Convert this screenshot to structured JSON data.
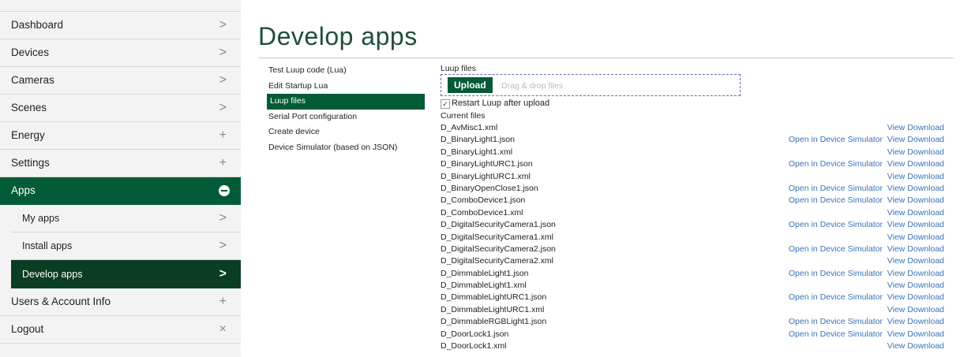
{
  "sidebar": {
    "items": [
      {
        "label": "Dashboard",
        "indicator": ">"
      },
      {
        "label": "Devices",
        "indicator": ">"
      },
      {
        "label": "Cameras",
        "indicator": ">"
      },
      {
        "label": "Scenes",
        "indicator": ">"
      },
      {
        "label": "Energy",
        "indicator": "+"
      },
      {
        "label": "Settings",
        "indicator": "+"
      },
      {
        "label": "Apps",
        "indicator": "minus-circle-icon"
      }
    ],
    "subitems": [
      {
        "label": "My apps",
        "indicator": ">"
      },
      {
        "label": "Install apps",
        "indicator": ">"
      },
      {
        "label": "Develop apps",
        "indicator": ">"
      }
    ],
    "bottom_items": [
      {
        "label": "Users & Account Info",
        "indicator": "+"
      },
      {
        "label": "Logout",
        "indicator": "×"
      }
    ]
  },
  "page": {
    "title": "Develop apps"
  },
  "submenu": {
    "items": [
      "Test Luup code (Lua)",
      "Edit Startup Lua",
      "Luup files",
      "Serial Port configuration",
      "Create device",
      "Device Simulator (based on JSON)"
    ]
  },
  "luup_files": {
    "heading": "Luup files",
    "upload_label": "Upload",
    "drop_hint": "Drag & drop files",
    "restart_label": "Restart Luup after upload",
    "restart_checked": true,
    "current_files_label": "Current files",
    "open_sim_label": "Open in Device Simulator",
    "view_label": "View",
    "download_label": "Download",
    "files": [
      {
        "name": "D_AvMisc1.xml",
        "sim": false
      },
      {
        "name": "D_BinaryLight1.json",
        "sim": true
      },
      {
        "name": "D_BinaryLight1.xml",
        "sim": false
      },
      {
        "name": "D_BinaryLightURC1.json",
        "sim": true
      },
      {
        "name": "D_BinaryLightURC1.xml",
        "sim": false
      },
      {
        "name": "D_BinaryOpenClose1.json",
        "sim": true
      },
      {
        "name": "D_ComboDevice1.json",
        "sim": true
      },
      {
        "name": "D_ComboDevice1.xml",
        "sim": false
      },
      {
        "name": "D_DigitalSecurityCamera1.json",
        "sim": true
      },
      {
        "name": "D_DigitalSecurityCamera1.xml",
        "sim": false
      },
      {
        "name": "D_DigitalSecurityCamera2.json",
        "sim": true
      },
      {
        "name": "D_DigitalSecurityCamera2.xml",
        "sim": false
      },
      {
        "name": "D_DimmableLight1.json",
        "sim": true
      },
      {
        "name": "D_DimmableLight1.xml",
        "sim": false
      },
      {
        "name": "D_DimmableLightURC1.json",
        "sim": true
      },
      {
        "name": "D_DimmableLightURC1.xml",
        "sim": false
      },
      {
        "name": "D_DimmableRGBLight1.json",
        "sim": true
      },
      {
        "name": "D_DoorLock1.json",
        "sim": true
      },
      {
        "name": "D_DoorLock1.xml",
        "sim": false
      }
    ]
  },
  "colors": {
    "accent": "#015b36",
    "accent_dark": "#0b3d24",
    "link": "#3a73b8",
    "title": "#1f4f3a"
  }
}
